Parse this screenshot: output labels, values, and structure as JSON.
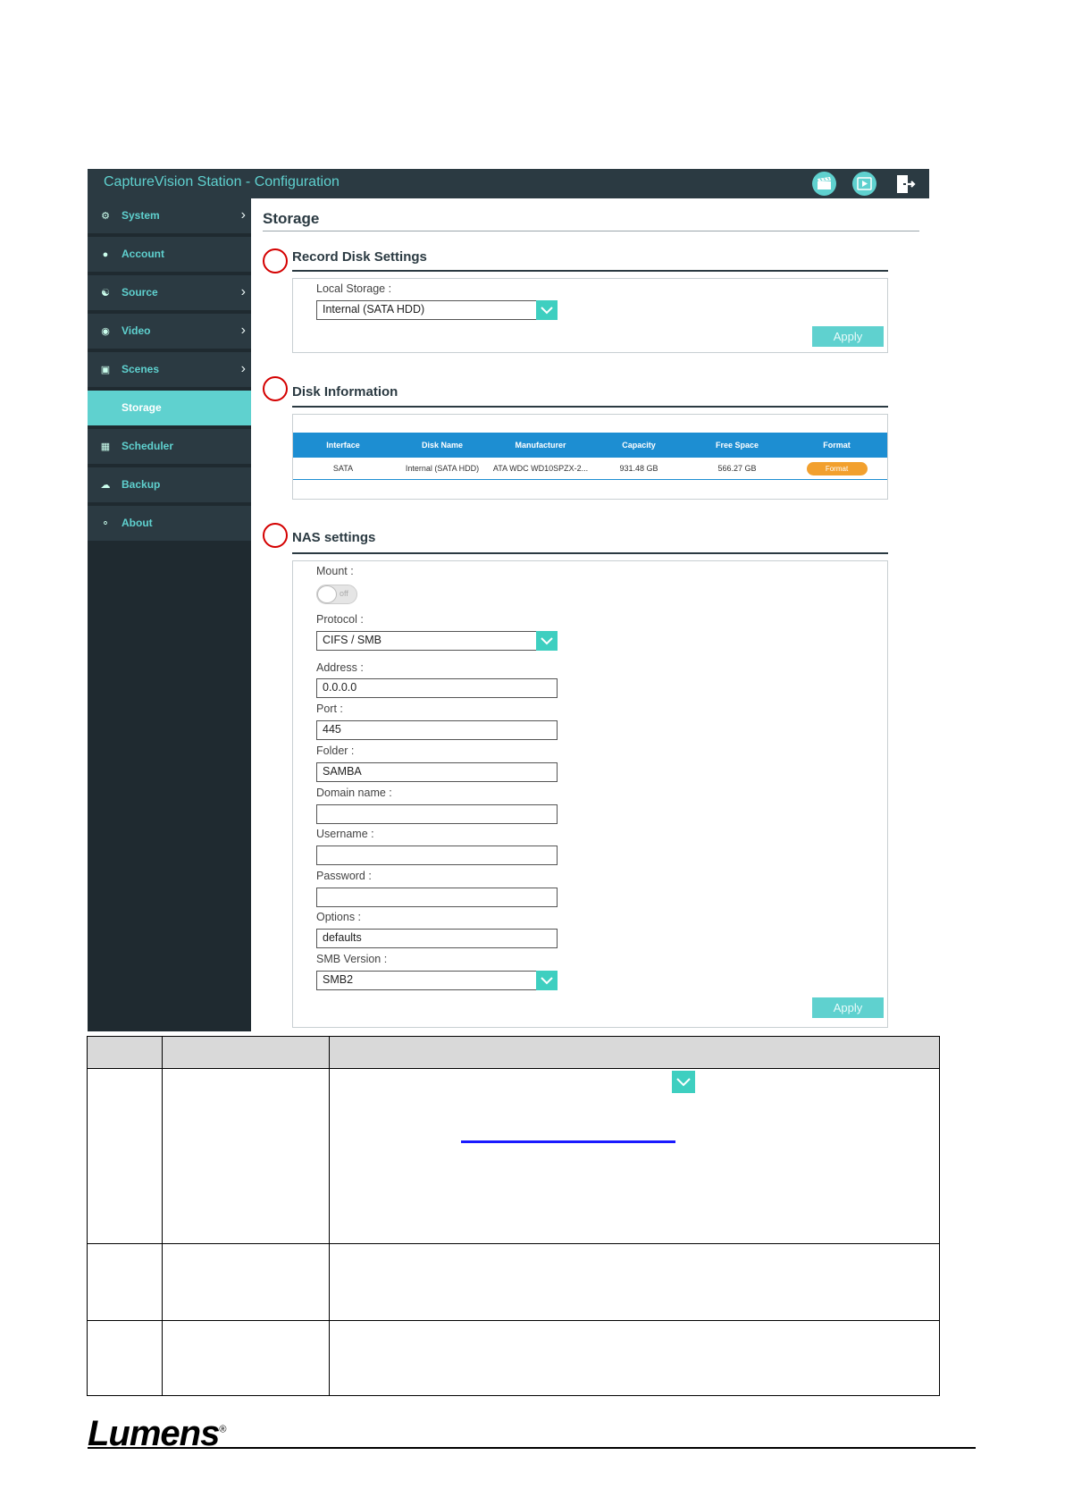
{
  "app": {
    "title": "CaptureVision Station - Configuration",
    "header_icons": [
      "clapperboard-icon",
      "play-icon",
      "logout-icon"
    ]
  },
  "sidebar": {
    "items": [
      {
        "label": "System",
        "icon": "gear-icon",
        "has_submenu": true,
        "active": false
      },
      {
        "label": "Account",
        "icon": "user-icon",
        "has_submenu": false,
        "active": false
      },
      {
        "label": "Source",
        "icon": "network-icon",
        "has_submenu": true,
        "active": false
      },
      {
        "label": "Video",
        "icon": "record-icon",
        "has_submenu": true,
        "active": false
      },
      {
        "label": "Scenes",
        "icon": "layout-icon",
        "has_submenu": true,
        "active": false
      },
      {
        "label": "Storage",
        "icon": "",
        "has_submenu": false,
        "active": true
      },
      {
        "label": "Scheduler",
        "icon": "calendar-icon",
        "has_submenu": false,
        "active": false
      },
      {
        "label": "Backup",
        "icon": "cloud-upload-icon",
        "has_submenu": false,
        "active": false
      },
      {
        "label": "About",
        "icon": "chat-icon",
        "has_submenu": false,
        "active": false
      }
    ]
  },
  "page": {
    "title": "Storage"
  },
  "record_disk": {
    "heading": "Record Disk Settings",
    "local_storage_label": "Local Storage :",
    "local_storage_value": "Internal (SATA HDD)",
    "apply_label": "Apply"
  },
  "disk_info": {
    "heading": "Disk Information",
    "columns": [
      "Interface",
      "Disk Name",
      "Manufacturer",
      "Capacity",
      "Free Space",
      "Format"
    ],
    "rows": [
      {
        "interface": "SATA",
        "disk_name": "Internal (SATA HDD)",
        "manufacturer": "ATA WDC WD10SPZX-2...",
        "capacity": "931.48 GB",
        "free_space": "566.27 GB",
        "format_label": "Format"
      }
    ]
  },
  "nas": {
    "heading": "NAS settings",
    "mount_label": "Mount :",
    "mount_state": "off",
    "protocol_label": "Protocol :",
    "protocol_value": "CIFS / SMB",
    "address_label": "Address :",
    "address_value": "0.0.0.0",
    "port_label": "Port :",
    "port_value": "445",
    "folder_label": "Folder :",
    "folder_value": "SAMBA",
    "domain_label": "Domain name :",
    "domain_value": "",
    "username_label": "Username :",
    "username_value": "",
    "password_label": "Password :",
    "password_value": "",
    "options_label": "Options :",
    "options_value": "defaults",
    "smb_version_label": "SMB Version :",
    "smb_version_value": "SMB2",
    "apply_label": "Apply"
  },
  "footer": {
    "brand": "Lumens",
    "registered_mark": "®"
  }
}
